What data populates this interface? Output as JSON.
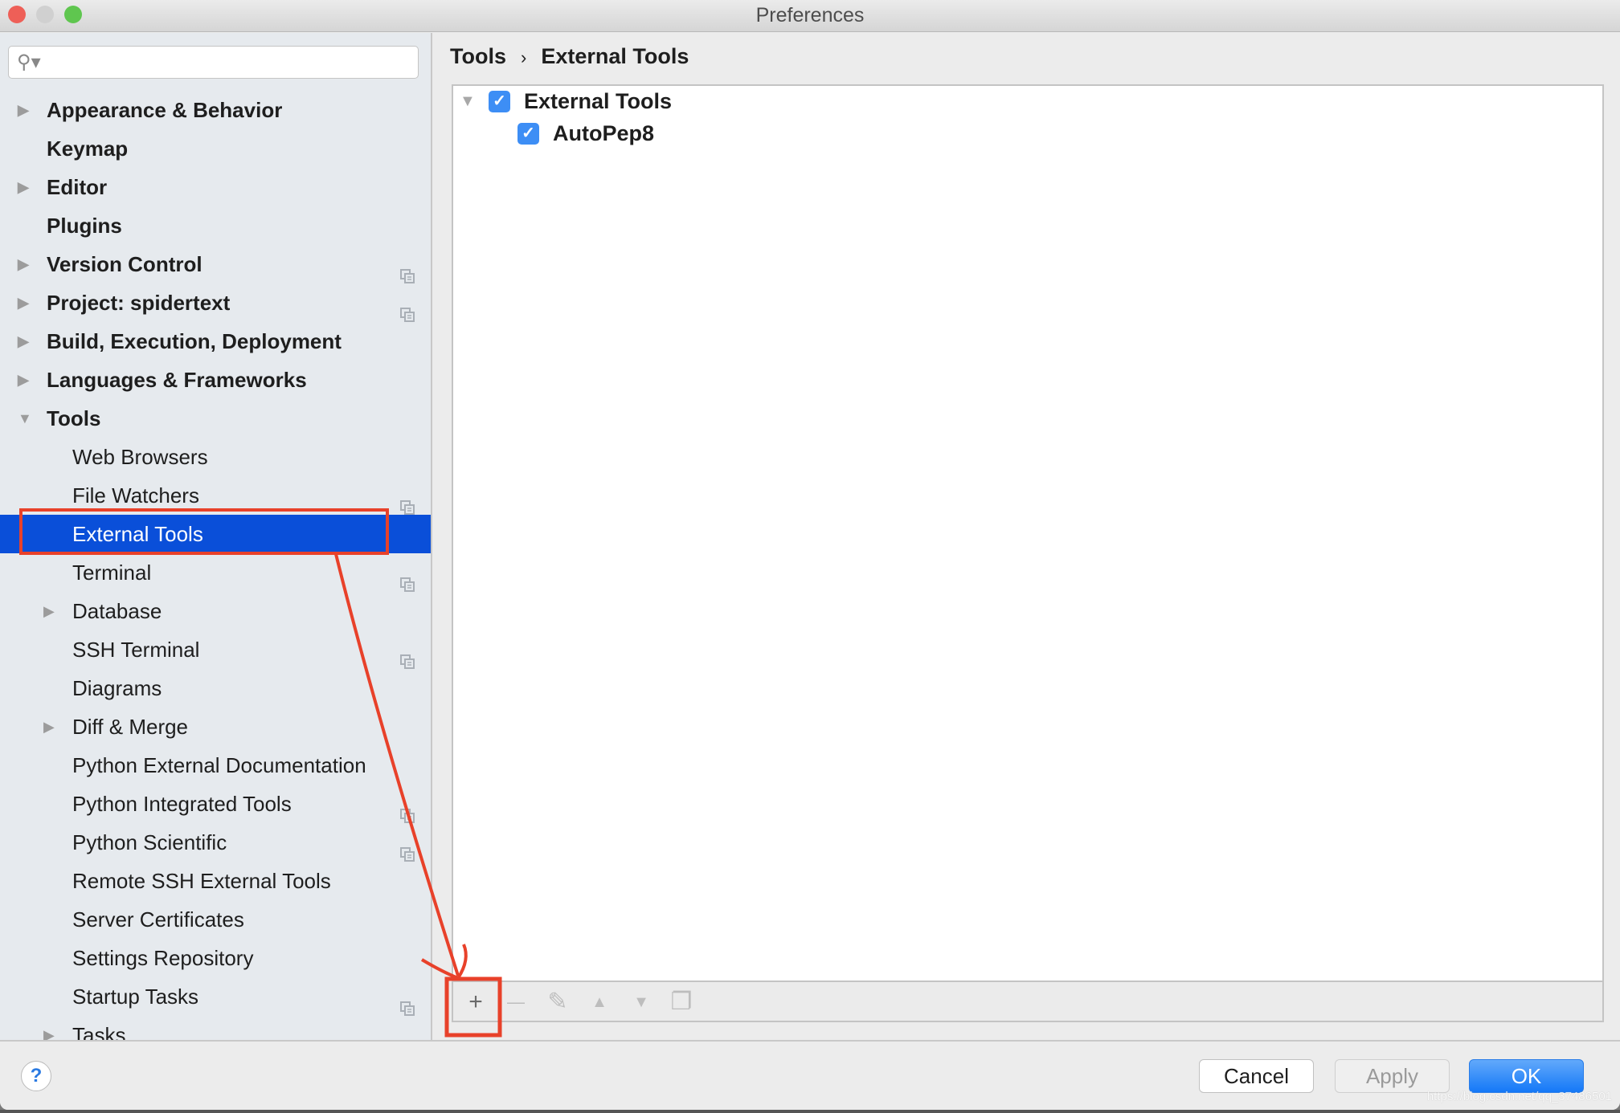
{
  "window": {
    "title": "Preferences"
  },
  "sidebar": {
    "search": {
      "placeholder": "",
      "icon": "search-icon"
    },
    "items": [
      {
        "label": "Appearance & Behavior",
        "level": 0,
        "expandable": true,
        "expanded": false,
        "copy": false
      },
      {
        "label": "Keymap",
        "level": 0,
        "expandable": false,
        "copy": false
      },
      {
        "label": "Editor",
        "level": 0,
        "expandable": true,
        "expanded": false,
        "copy": false
      },
      {
        "label": "Plugins",
        "level": 0,
        "expandable": false,
        "copy": false
      },
      {
        "label": "Version Control",
        "level": 0,
        "expandable": true,
        "expanded": false,
        "copy": true
      },
      {
        "label": "Project: spidertext",
        "level": 0,
        "expandable": true,
        "expanded": false,
        "copy": true
      },
      {
        "label": "Build, Execution, Deployment",
        "level": 0,
        "expandable": true,
        "expanded": false,
        "copy": false
      },
      {
        "label": "Languages & Frameworks",
        "level": 0,
        "expandable": true,
        "expanded": false,
        "copy": false
      },
      {
        "label": "Tools",
        "level": 0,
        "expandable": true,
        "expanded": true,
        "copy": false
      },
      {
        "label": "Web Browsers",
        "level": 1,
        "expandable": false,
        "copy": false
      },
      {
        "label": "File Watchers",
        "level": 1,
        "expandable": false,
        "copy": true
      },
      {
        "label": "External Tools",
        "level": 1,
        "expandable": false,
        "copy": false,
        "selected": true
      },
      {
        "label": "Terminal",
        "level": 1,
        "expandable": false,
        "copy": true
      },
      {
        "label": "Database",
        "level": 1,
        "expandable": true,
        "expanded": false,
        "copy": false
      },
      {
        "label": "SSH Terminal",
        "level": 1,
        "expandable": false,
        "copy": true
      },
      {
        "label": "Diagrams",
        "level": 1,
        "expandable": false,
        "copy": false
      },
      {
        "label": "Diff & Merge",
        "level": 1,
        "expandable": true,
        "expanded": false,
        "copy": false
      },
      {
        "label": "Python External Documentation",
        "level": 1,
        "expandable": false,
        "copy": false
      },
      {
        "label": "Python Integrated Tools",
        "level": 1,
        "expandable": false,
        "copy": true
      },
      {
        "label": "Python Scientific",
        "level": 1,
        "expandable": false,
        "copy": true
      },
      {
        "label": "Remote SSH External Tools",
        "level": 1,
        "expandable": false,
        "copy": false
      },
      {
        "label": "Server Certificates",
        "level": 1,
        "expandable": false,
        "copy": false
      },
      {
        "label": "Settings Repository",
        "level": 1,
        "expandable": false,
        "copy": false
      },
      {
        "label": "Startup Tasks",
        "level": 1,
        "expandable": false,
        "copy": true
      },
      {
        "label": "Tasks",
        "level": 1,
        "expandable": true,
        "expanded": false,
        "copy": true
      }
    ]
  },
  "main": {
    "breadcrumb": [
      "Tools",
      "External Tools"
    ],
    "breadcrumb_separator": "›",
    "tree": [
      {
        "label": "External Tools",
        "checked": true,
        "expanded": true
      },
      {
        "label": "AutoPep8",
        "checked": true
      }
    ],
    "toolbar": [
      {
        "name": "add",
        "glyph": "+",
        "enabled": true
      },
      {
        "name": "remove",
        "glyph": "—",
        "enabled": false
      },
      {
        "name": "edit",
        "glyph": "✎",
        "enabled": false
      },
      {
        "name": "move-up",
        "glyph": "▲",
        "enabled": false
      },
      {
        "name": "move-down",
        "glyph": "▼",
        "enabled": false
      },
      {
        "name": "copy",
        "glyph": "❐",
        "enabled": false
      }
    ]
  },
  "footer": {
    "help": "?",
    "cancel": "Cancel",
    "apply": "Apply",
    "ok": "OK"
  },
  "watermark": "https://blog.csdn.net/qq_37486501",
  "colors": {
    "selection": "#0a4fd9",
    "checkbox": "#3d8ef5",
    "ok": "#1a7ff5",
    "annotation": "#e8412a"
  }
}
